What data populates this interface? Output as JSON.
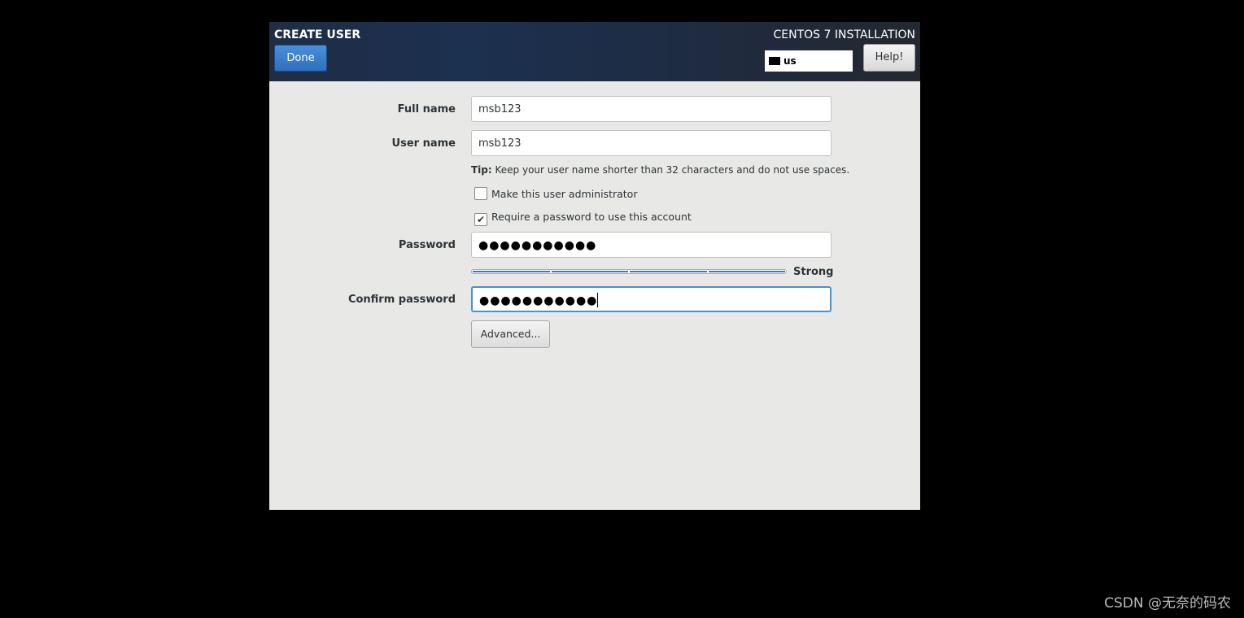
{
  "header": {
    "title": "CREATE USER",
    "product": "CENTOS 7 INSTALLATION",
    "done": "Done",
    "keyboard": "us",
    "help": "Help!"
  },
  "form": {
    "full_name_label": "Full name",
    "full_name": "msb123",
    "user_name_label": "User name",
    "user_name": "msb123",
    "tip_bold": "Tip:",
    "tip": " Keep your user name shorter than 32 characters and do not use spaces.",
    "admin_label": "Make this user administrator",
    "admin_checked": false,
    "require_pw_label": "Require a password to use this account",
    "require_pw_checked": true,
    "password_label": "Password",
    "password": "●●●●●●●●●●●",
    "strength": "Strong",
    "strength_level": 1.0,
    "confirm_label": "Confirm password",
    "confirm": "●●●●●●●●●●●",
    "advanced": "Advanced..."
  },
  "watermark": "CSDN @无奈的码农"
}
